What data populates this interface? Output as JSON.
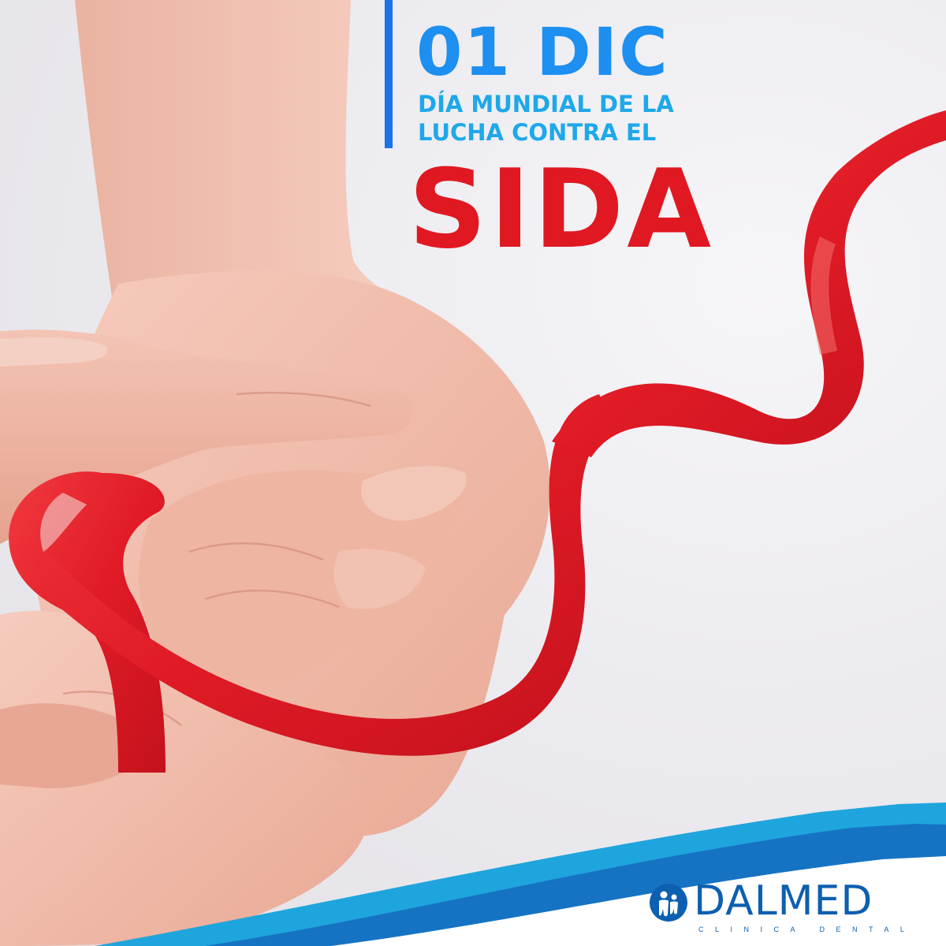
{
  "headline": {
    "date": "01 DIC",
    "subtitle_line1": "DÍA MUNDIAL DE LA",
    "subtitle_line2": "LUCHA CONTRA EL",
    "disease": "SIDA"
  },
  "brand": {
    "name": "DALMED",
    "tagline": "CLINICA DENTAL",
    "logo_icon": "tooth-family-icon"
  },
  "photo": {
    "subject": "hands-holding-red-ribbon",
    "ribbon_color": "#e5232b",
    "skin_color": "#f1b8a6"
  },
  "colors": {
    "date_blue": "#1d8ff0",
    "subtitle_blue": "#1ea8ea",
    "accent_bar": "#1a73e8",
    "sida_red": "#e01822",
    "footer_light": "#1fa5dd",
    "footer_dark": "#1673c4",
    "logo_blue": "#0d5fb0"
  }
}
